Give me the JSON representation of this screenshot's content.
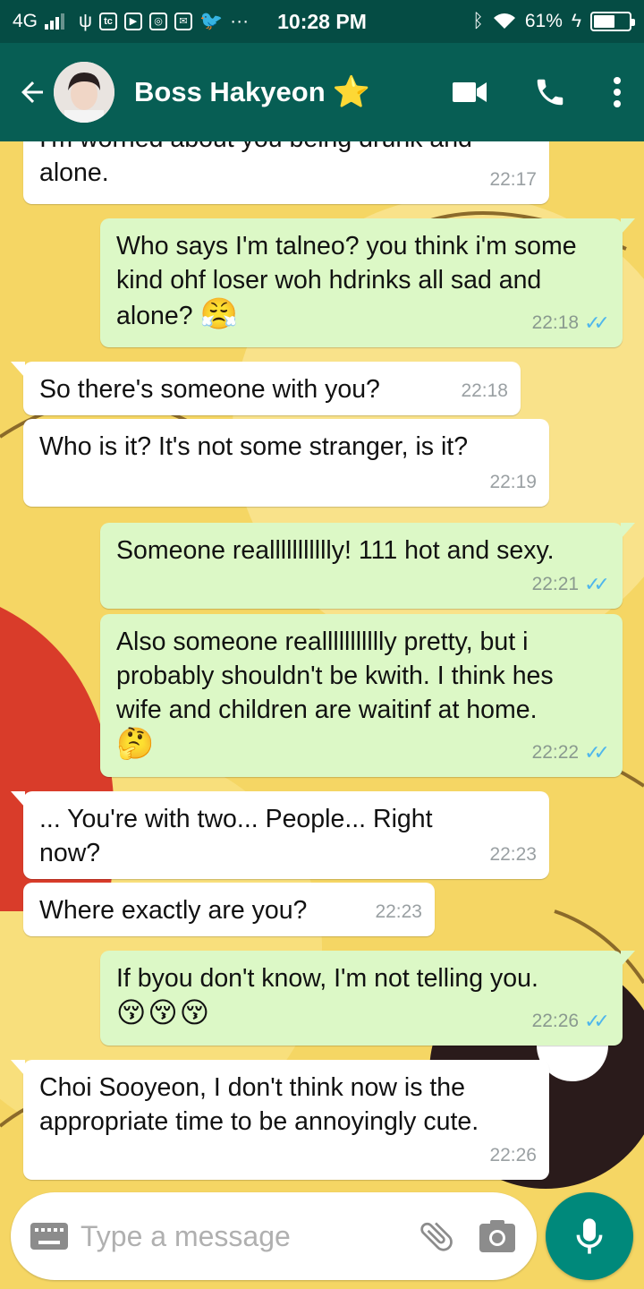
{
  "status_bar": {
    "network": "4G",
    "time": "10:28 PM",
    "more": "···",
    "battery_percent": "61%",
    "battery_level": 0.61
  },
  "header": {
    "contact_name": "Boss Hakyeon",
    "star": "⭐"
  },
  "messages": [
    {
      "dir": "in",
      "text": "I'm worried about you being drunk and alone.",
      "time": "22:17"
    },
    {
      "dir": "out",
      "text": "Who says I'm talneo? you think i'm some kind ohf loser woh hdrinks all sad and alone?",
      "emoji": "😤",
      "time": "22:18"
    },
    {
      "dir": "in",
      "text": "So there's someone with you?",
      "time": "22:18"
    },
    {
      "dir": "in",
      "text": "Who is it? It's not some stranger, is it?",
      "time": "22:19"
    },
    {
      "dir": "out",
      "text": "Someone reallllllllllly! 111 hot and sexy.",
      "time": "22:21"
    },
    {
      "dir": "out",
      "text": "Also someone reallllllllllly pretty, but i probably shouldn't be kwith. I think hes wife and children are waitinf at home.",
      "emoji": "🤔",
      "time": "22:22"
    },
    {
      "dir": "in",
      "text": "... You're with two... People... Right now?",
      "time": "22:23"
    },
    {
      "dir": "in",
      "text": "Where exactly are you?",
      "time": "22:23"
    },
    {
      "dir": "out",
      "text": "If byou don't know, I'm not telling you.",
      "emoji": "😚😚😚",
      "time": "22:26"
    },
    {
      "dir": "in",
      "text": "Choi Sooyeon, I don't think now is the appropriate time to be annoyingly cute.",
      "time": "22:26"
    }
  ],
  "composer": {
    "placeholder": "Type a message"
  },
  "icons": {
    "back": "arrow-left-icon",
    "video": "video-call-icon",
    "call": "phone-icon",
    "menu": "more-vert-icon",
    "keyboard": "keyboard-icon",
    "attach": "paperclip-icon",
    "camera": "camera-icon",
    "mic": "microphone-icon"
  },
  "colors": {
    "header": "#075e54",
    "status_bar": "#054c44",
    "incoming_bubble": "#ffffff",
    "outgoing_bubble": "#dcf8c6",
    "read_ticks": "#4fb6ec",
    "mic_button": "#00897b"
  }
}
